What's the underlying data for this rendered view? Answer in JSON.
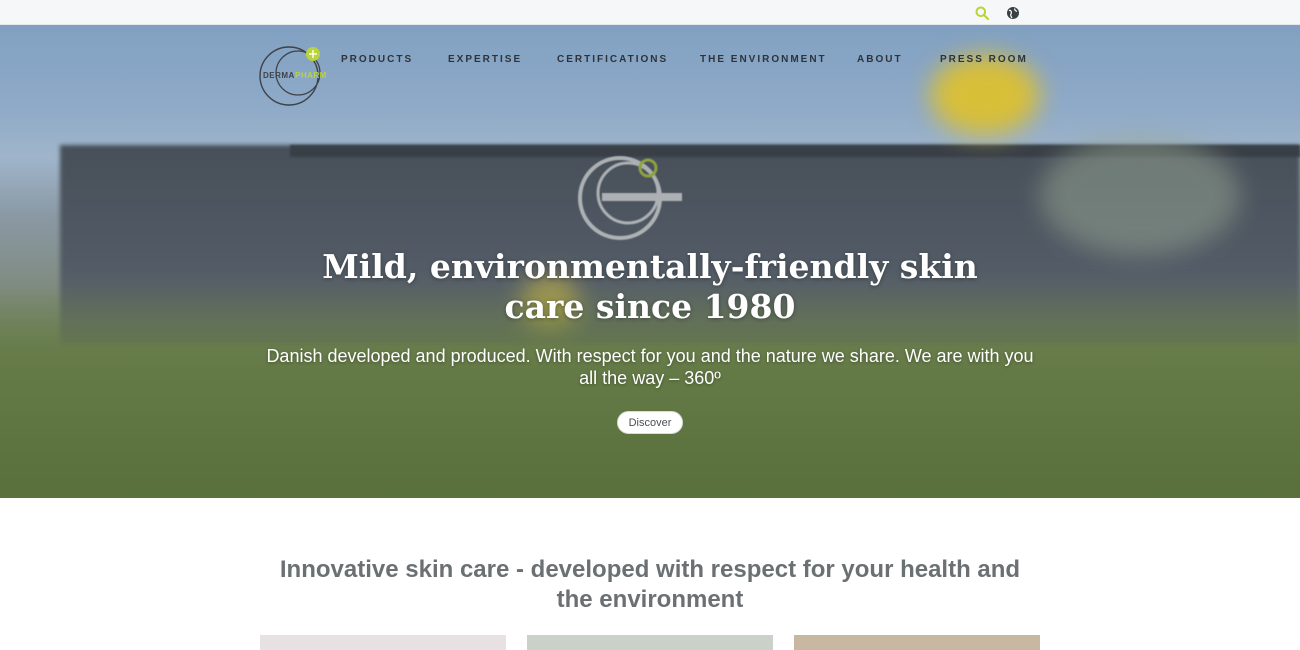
{
  "topbar": {
    "icons": [
      "search-icon",
      "globe-icon"
    ]
  },
  "brand": {
    "logo_text_left": "DERMA",
    "logo_text_right": "PHARM",
    "accent_color": "#b9d33a"
  },
  "nav": {
    "items": [
      "PRODUCTS",
      "EXPERTISE",
      "CERTIFICATIONS",
      "THE ENVIRONMENT",
      "ABOUT",
      "PRESS ROOM"
    ]
  },
  "hero": {
    "title": "Mild, environmentally-friendly skin care since 1980",
    "subtitle": "Danish developed and produced. With respect for you and the nature we share. We are with you all the way – 360º",
    "button_label": "Discover"
  },
  "intro": {
    "title": "Innovative skin care - developed with respect for your health and the environment"
  },
  "cards": {
    "colors": [
      "#e7e1e3",
      "#c9d1c8",
      "#c8b8a2"
    ]
  }
}
